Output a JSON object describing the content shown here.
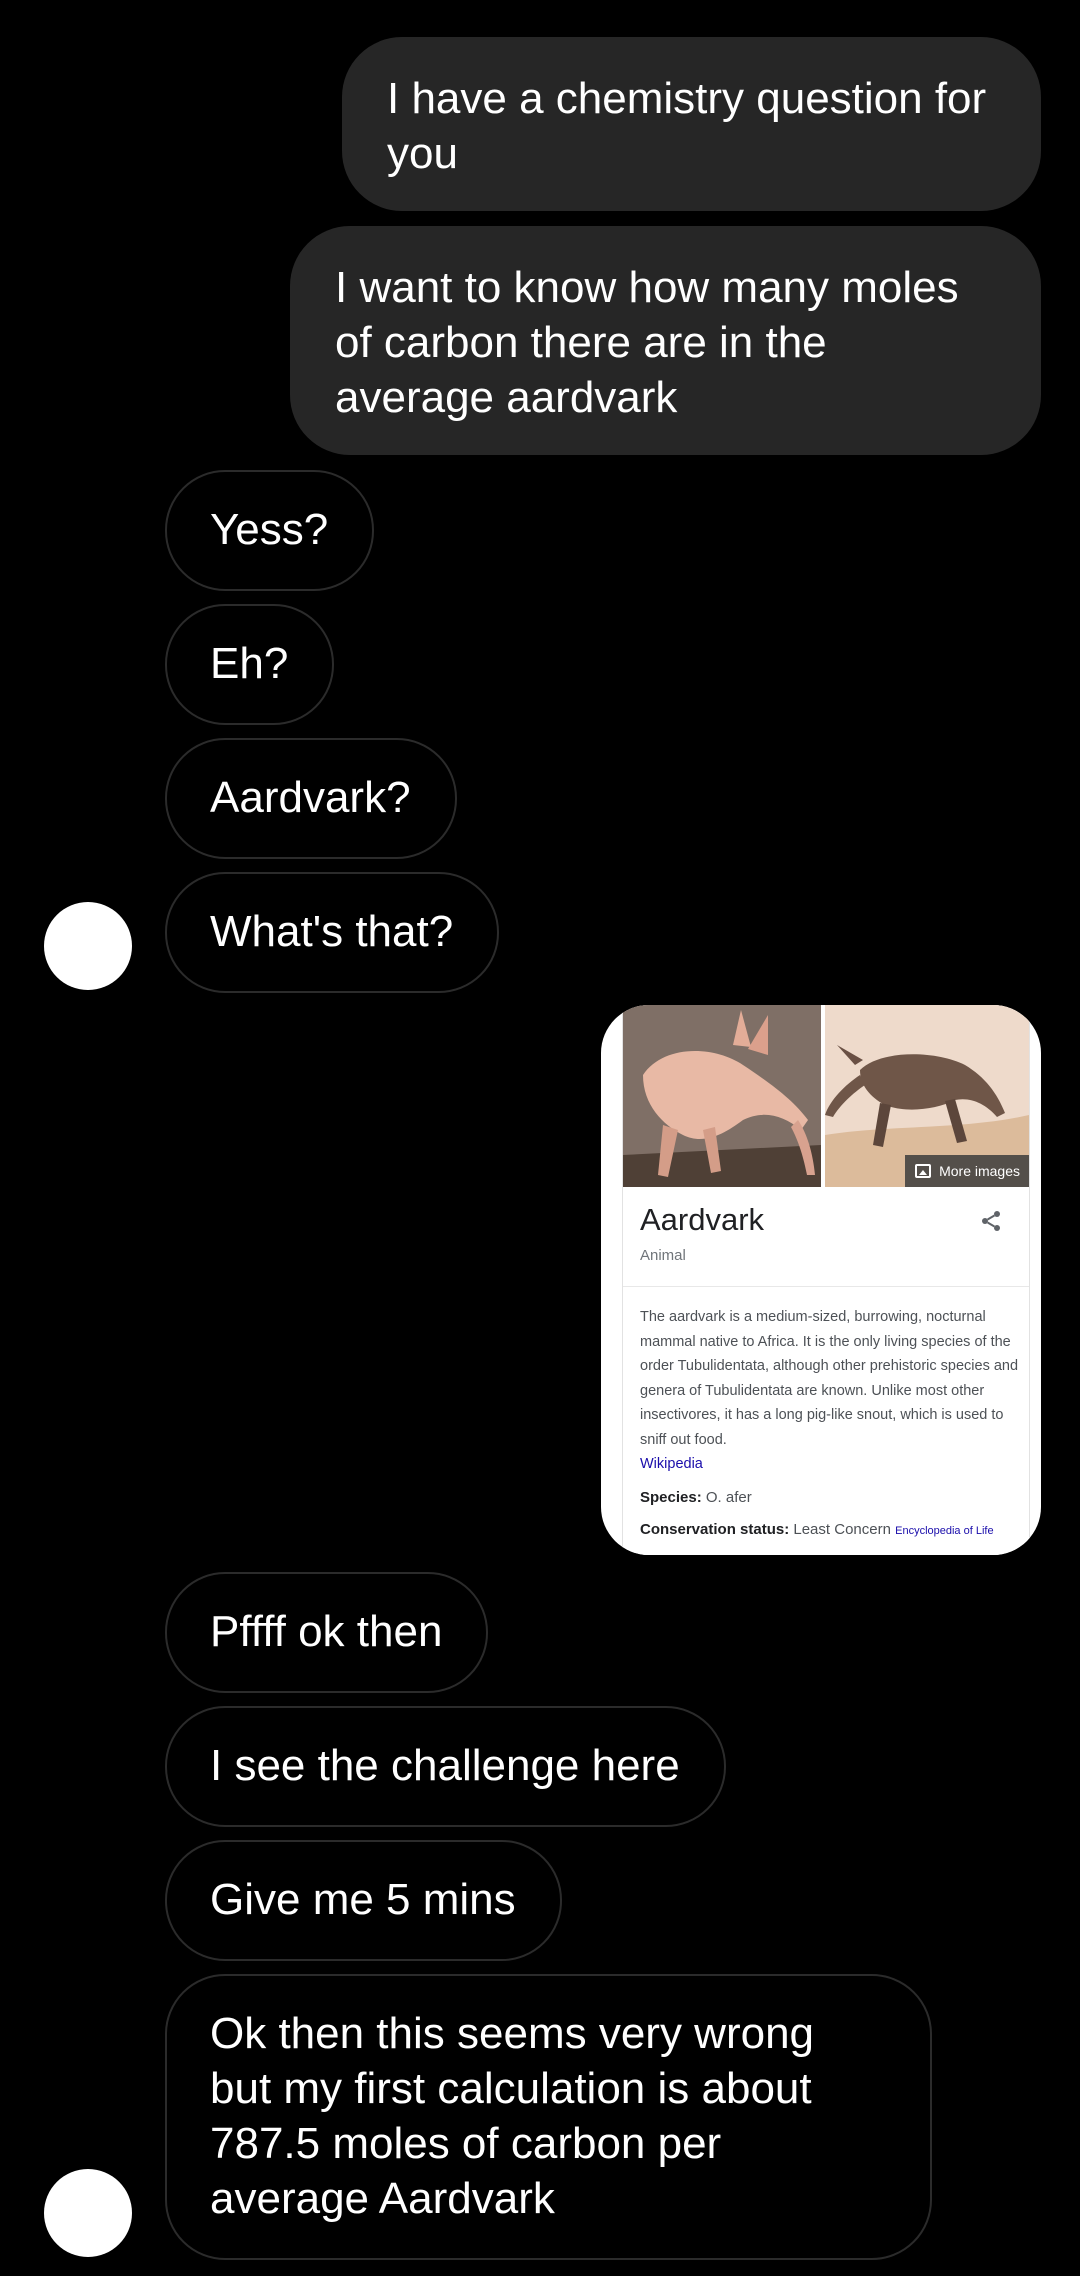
{
  "messages": {
    "sent_1": "I have a chemistry question for you",
    "sent_2": "I want to know how many moles of carbon there are in the average aardvark",
    "recv_1": "Yess?",
    "recv_2": "Eh?",
    "recv_3": "Aardvark?",
    "recv_4": "What's that?",
    "recv_5": "Pffff ok then",
    "recv_6": "I see the challenge here",
    "recv_7": "Give me 5 mins",
    "recv_8": "Ok then this seems very wrong but my first calculation is about 787.5 moles of carbon per average Aardvark"
  },
  "shared_card": {
    "more_images": "More images",
    "title": "Aardvark",
    "subtitle": "Animal",
    "description": "The aardvark is a medium-sized, burrowing, nocturnal mammal native to Africa. It is the only living species of the order Tubulidentata, although other prehistoric species and genera of Tubulidentata are known. Unlike most other insectivores, it has a long pig-like snout, which is used to sniff out food.",
    "source_link": "Wikipedia",
    "species_label": "Species:",
    "species_value": "O. afer",
    "conservation_label": "Conservation status:",
    "conservation_value": "Least Concern",
    "conservation_source": "Encyclopedia of Life"
  },
  "icons": {
    "avatar": "avatar",
    "share": "share-icon",
    "images": "image-icon"
  },
  "colors": {
    "background": "#000000",
    "sent_bubble": "#262626",
    "received_border": "#2b2b2b",
    "text": "#ffffff",
    "link": "#1a0dab"
  }
}
